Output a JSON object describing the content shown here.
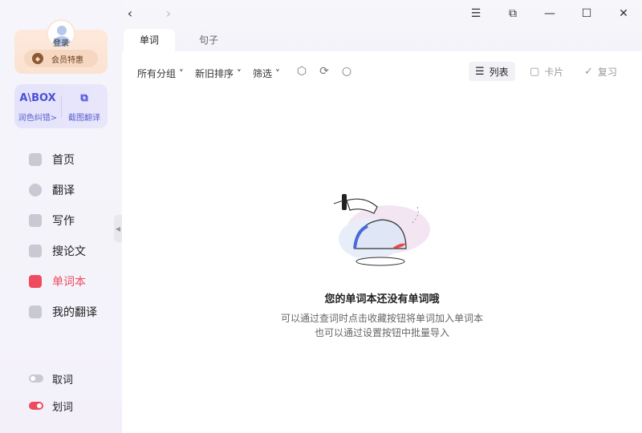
{
  "user": {
    "login_label": "登录",
    "vip_label": "会员特惠"
  },
  "tools": [
    {
      "icon_text": "A\\BOX",
      "label": "润色纠错>"
    },
    {
      "icon_text": "⧉",
      "label": "截图翻译"
    }
  ],
  "nav": [
    {
      "label": "首页",
      "icon": "home-icon"
    },
    {
      "label": "翻译",
      "icon": "translate-icon"
    },
    {
      "label": "写作",
      "icon": "write-icon"
    },
    {
      "label": "搜论文",
      "icon": "paper-icon"
    },
    {
      "label": "单词本",
      "icon": "wordbook-icon",
      "active": true
    },
    {
      "label": "我的翻译",
      "icon": "my-translation-icon"
    }
  ],
  "toggles": [
    {
      "label": "取词",
      "on": false
    },
    {
      "label": "划词",
      "on": true
    }
  ],
  "tabs": [
    {
      "label": "单词",
      "active": true
    },
    {
      "label": "句子",
      "active": false
    }
  ],
  "filters": {
    "group": "所有分组",
    "sort": "新旧排序",
    "filter": "筛选"
  },
  "views": {
    "list": "列表",
    "card": "卡片",
    "review": "复习"
  },
  "empty": {
    "title": "您的单词本还没有单词哦",
    "line1": "可以通过查词时点击收藏按钮将单词加入单词本",
    "line2": "也可以通过设置按钮中批量导入"
  },
  "colors": {
    "accent": "#ef4a5e",
    "brand": "#4a4fd8"
  }
}
